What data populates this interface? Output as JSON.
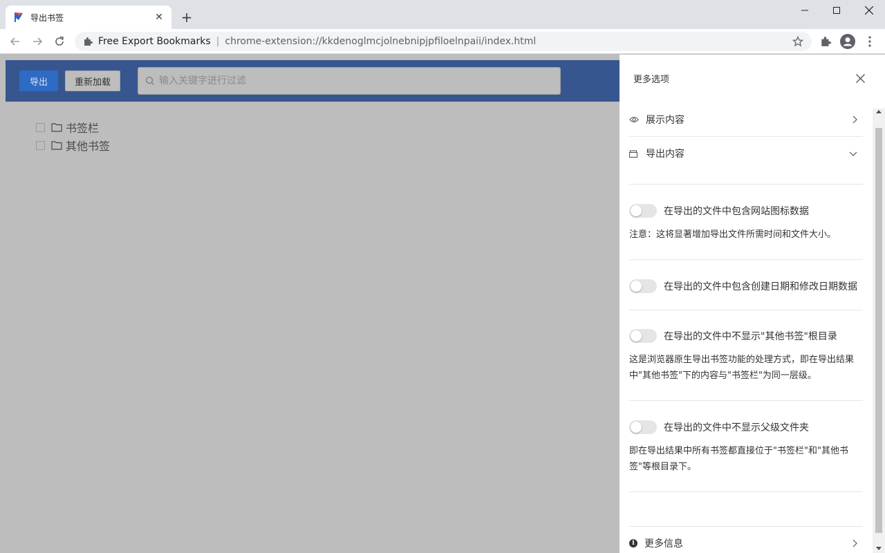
{
  "browser": {
    "tab_title": "导出书签",
    "site_name": "Free Export Bookmarks",
    "url": "chrome-extension://kkdenoglmcjolnebnipjpfiloelnpaii/index.html"
  },
  "header": {
    "export_label": "导出",
    "reload_label": "重新加载",
    "search_placeholder": "输入关键字进行过滤"
  },
  "tree": {
    "items": [
      {
        "label": "书签栏"
      },
      {
        "label": "其他书签"
      }
    ]
  },
  "drawer": {
    "title": "更多选项",
    "sections": {
      "display": "展示内容",
      "export": "导出内容"
    },
    "options": [
      {
        "label": "在导出的文件中包含网站图标数据",
        "note": "注意：这将显著增加导出文件所需时间和文件大小。"
      },
      {
        "label": "在导出的文件中包含创建日期和修改日期数据",
        "note": ""
      },
      {
        "label": "在导出的文件中不显示\"其他书签\"根目录",
        "note": "这是浏览器原生导出书签功能的处理方式，即在导出结果中\"其他书签\"下的内容与\"书签栏\"为同一层级。"
      },
      {
        "label": "在导出的文件中不显示父级文件夹",
        "note": "即在导出结果中所有书签都直接位于\"书签栏\"和\"其他书签\"等根目录下。"
      }
    ],
    "more_info": "更多信息"
  },
  "colors": {
    "header_bg": "#37568f",
    "export_button": "#2d6bc4",
    "overlay": "#bdbdbd"
  }
}
